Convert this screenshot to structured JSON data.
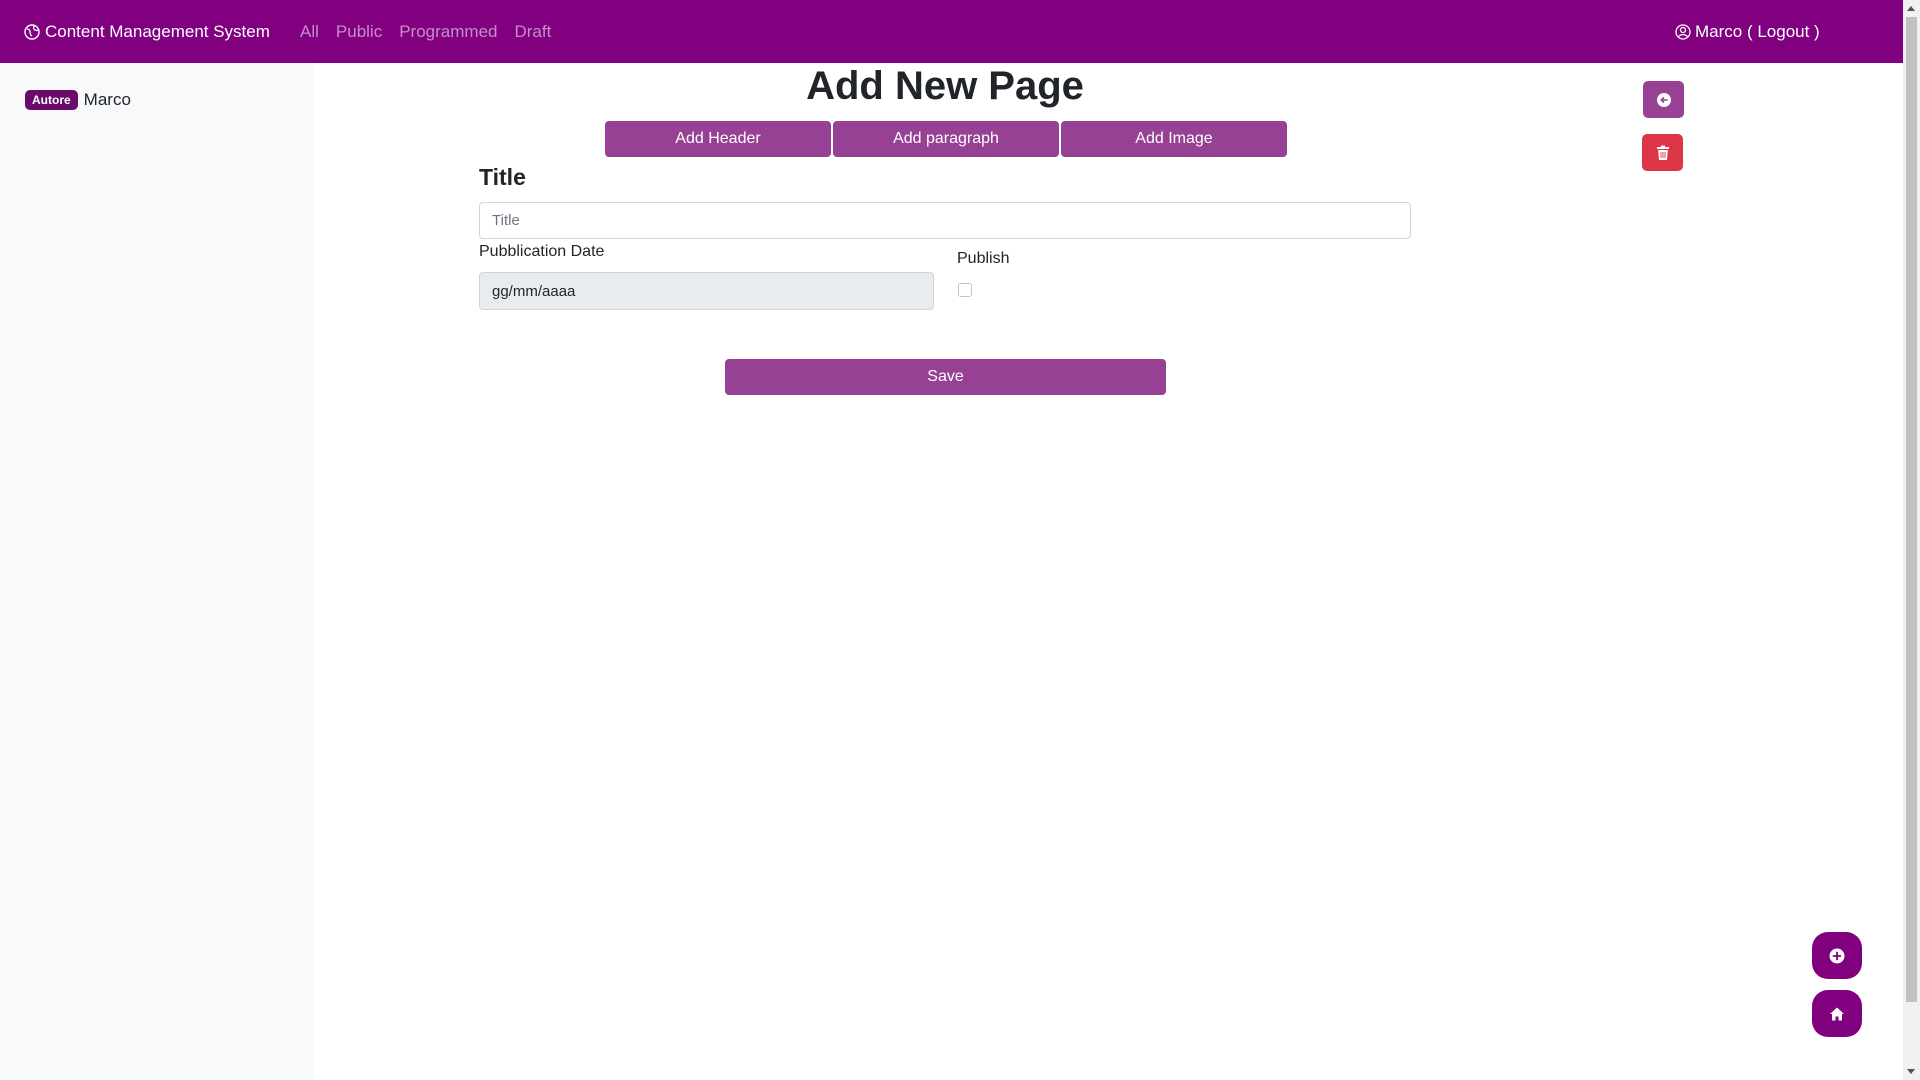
{
  "navbar": {
    "brand": "Content Management System",
    "brand_icon": "globe-icon",
    "links": [
      "All",
      "Public",
      "Programmed",
      "Draft"
    ],
    "user": "Marco ( Logout )",
    "user_icon": "person-circle-icon",
    "background_color": "#800080"
  },
  "sidebar": {
    "badge": "Autore",
    "author": "Marco"
  },
  "main": {
    "heading": "Add New Page",
    "add_buttons": [
      "Add Header",
      "Add paragraph",
      "Add Image"
    ],
    "form": {
      "title_label": "Title",
      "title_placeholder": "Title",
      "date_label": "Pubblication Date",
      "date_value": "gg/mm/aaaa",
      "publish_label": "Publish",
      "publish_checked": false,
      "save_label": "Save"
    },
    "accent_color": "#974195"
  },
  "actions": {
    "back_icon": "arrow-left-circle-icon",
    "delete_icon": "trash-icon",
    "delete_color": "#dc3545"
  },
  "floating": {
    "add_icon": "plus-circle-icon",
    "home_icon": "house-icon"
  }
}
